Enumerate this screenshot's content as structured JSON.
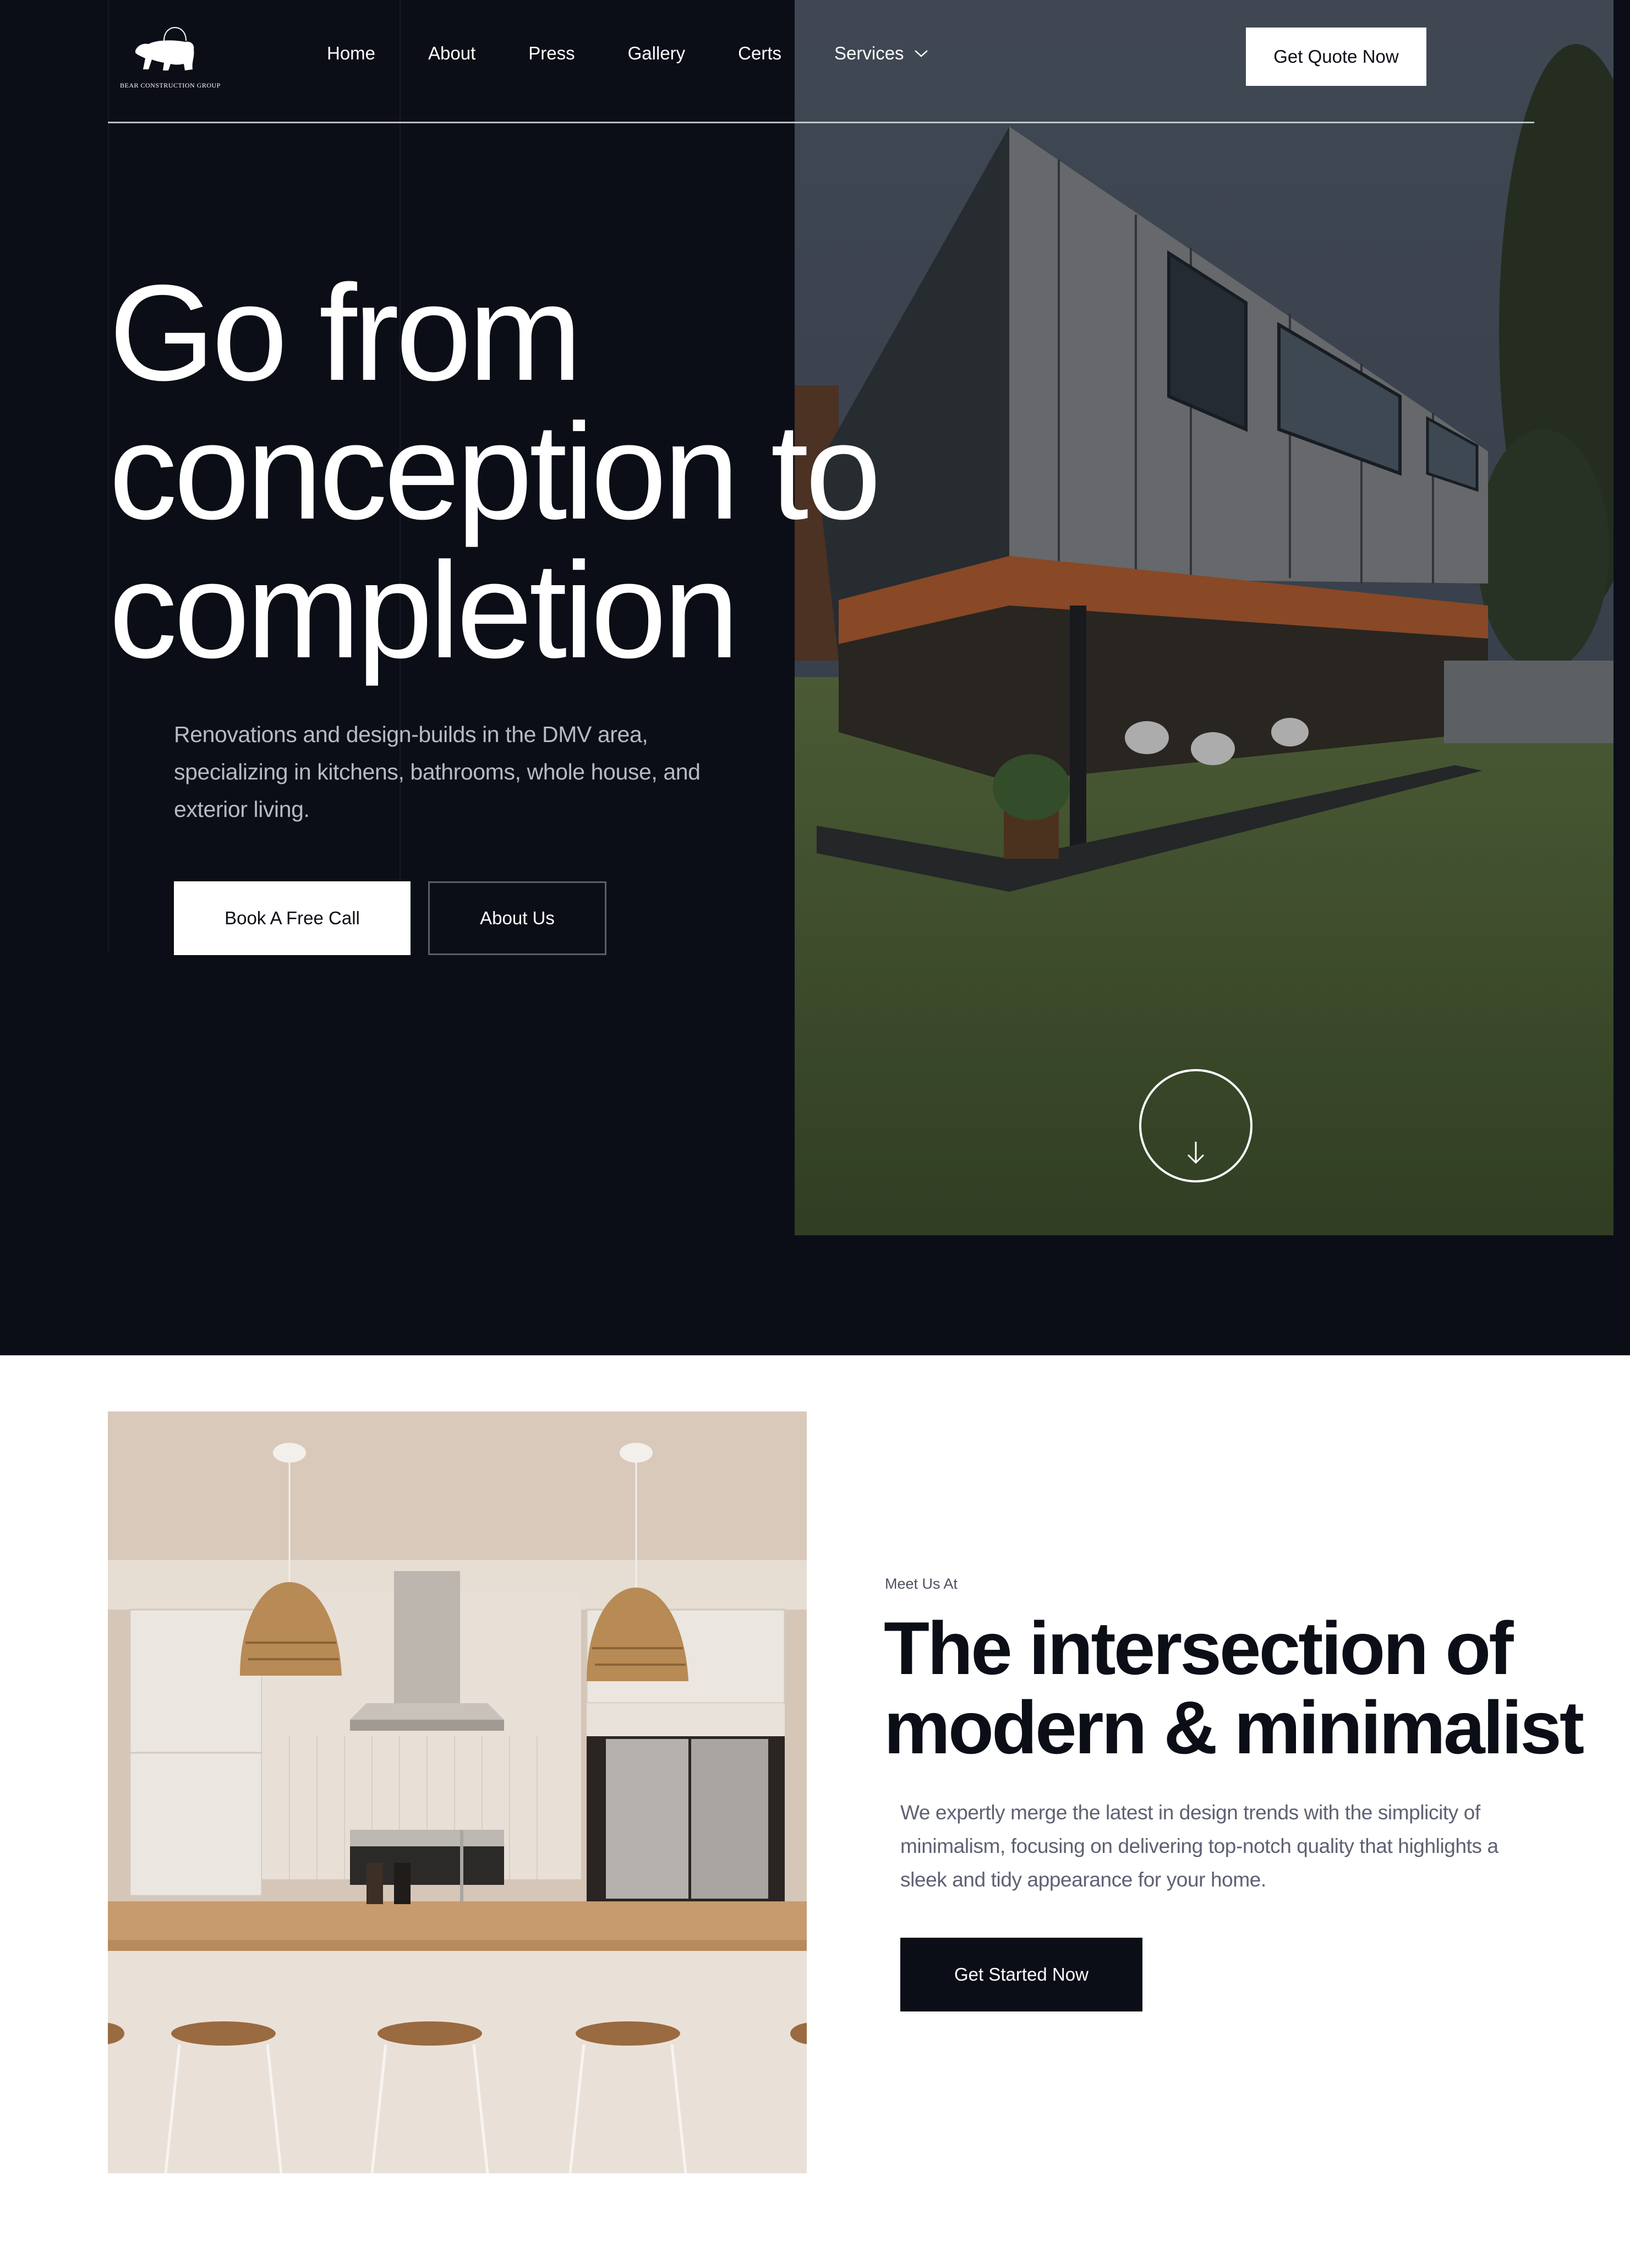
{
  "brand": {
    "name": "BEAR CONSTRUCTION GROUP",
    "logo_icon": "bear-icon"
  },
  "nav": {
    "items": [
      {
        "label": "Home"
      },
      {
        "label": "About"
      },
      {
        "label": "Press"
      },
      {
        "label": "Gallery"
      },
      {
        "label": "Certs"
      },
      {
        "label": "Services",
        "icon": "chevron-down-icon"
      }
    ],
    "cta_label": "Get Quote Now"
  },
  "hero": {
    "title_lines": [
      "Go from",
      "conception to",
      "completion"
    ],
    "subtitle": "Renovations and design-builds in the DMV area, specializing in kitchens, bathrooms, whole house, and exterior living.",
    "primary_button": "Book A Free Call",
    "secondary_button": "About Us",
    "scroll_icon": "arrow-down-icon",
    "image_alt": "Modern two-story house with wood-clad overhang and lawn"
  },
  "intro": {
    "eyebrow": "Meet Us At",
    "title_lines": [
      "The intersection of",
      "modern & minimalist"
    ],
    "body": "We expertly merge the latest in design trends with the simplicity of minimalism, focusing on delivering top-notch quality that highlights a sleek and tidy appearance for your home.",
    "button": "Get Started Now",
    "image_alt": "Minimalist kitchen with woven pendant lights and wooden bar stools"
  },
  "colors": {
    "dark": "#0b0e16",
    "white": "#ffffff",
    "muted_text_dark": "#b7bac2",
    "muted_text_light": "#5e6173",
    "outline_border": "#5a5e6b"
  }
}
